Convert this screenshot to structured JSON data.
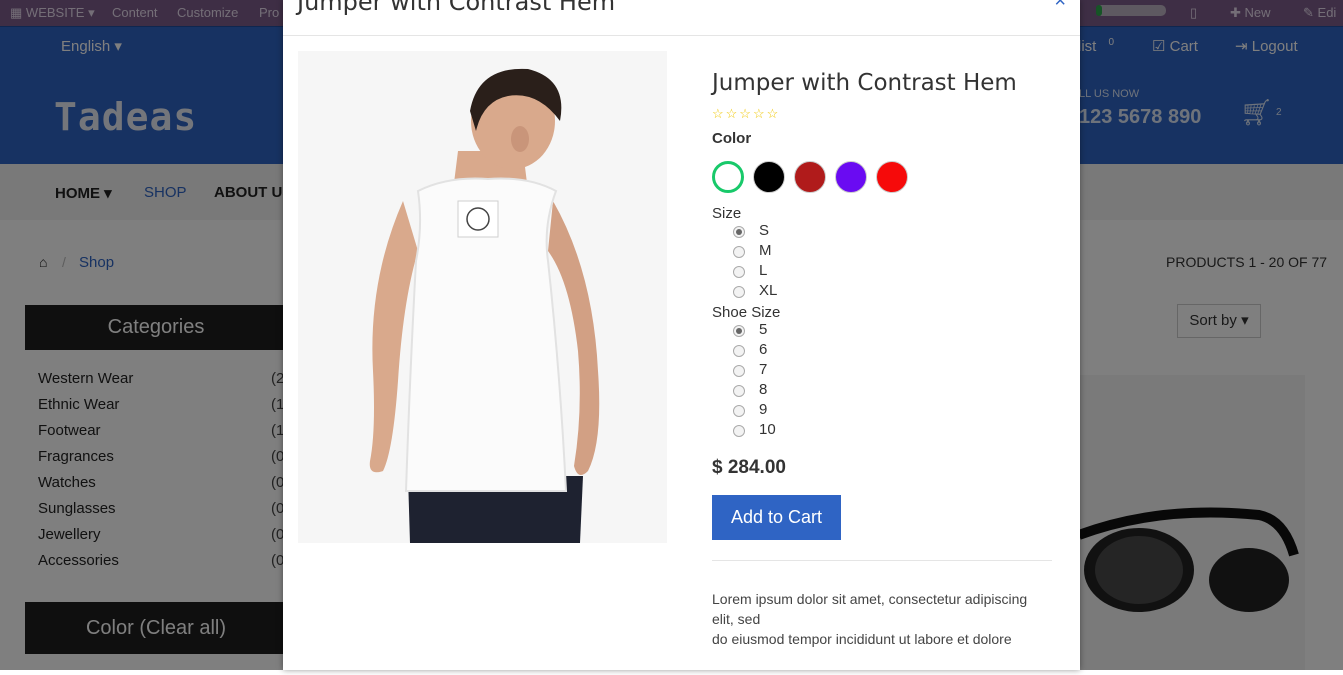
{
  "admin_bar": {
    "website_label": "WEBSITE",
    "content_label": "Content",
    "customize_label": "Customize",
    "promote_label": "Pro",
    "new_label": "New",
    "edit_label": "Edi"
  },
  "top_nav": {
    "language": "English",
    "wishlist_label": "list",
    "wishlist_count": "0",
    "cart_label": "Cart",
    "logout_label": "Logout"
  },
  "header": {
    "logo": "Tadeas",
    "call_label": "LL US NOW",
    "phone": "123 5678 890",
    "cart_count": "2"
  },
  "menu": {
    "home": "HOME",
    "shop": "SHOP",
    "about": "ABOUT US"
  },
  "breadcrumb": {
    "shop": "Shop"
  },
  "products_count": "PRODUCTS 1 - 20 OF 77",
  "sort_label": "Sort by",
  "sidebar": {
    "categories_title": "Categories",
    "categories": [
      {
        "label": "Western Wear",
        "count": "(2"
      },
      {
        "label": "Ethnic Wear",
        "count": "(1"
      },
      {
        "label": "Footwear",
        "count": "(1"
      },
      {
        "label": "Fragrances",
        "count": "(0"
      },
      {
        "label": "Watches",
        "count": "(0"
      },
      {
        "label": "Sunglasses",
        "count": "(0"
      },
      {
        "label": "Jewellery",
        "count": "(0"
      },
      {
        "label": "Accessories",
        "count": "(0"
      }
    ],
    "color_title": "Color (Clear all)"
  },
  "modal": {
    "title": "Jumper with Contrast Hem",
    "close": "×",
    "product_name": "Jumper with Contrast Hem",
    "rating_stars": "☆☆☆☆☆",
    "color_label": "Color",
    "colors": [
      "#ffffff",
      "#000000",
      "#b01b1b",
      "#6a0bf2",
      "#f60a0a"
    ],
    "selected_color_ring": "#18c96a",
    "size_label": "Size",
    "sizes": [
      "S",
      "M",
      "L",
      "XL"
    ],
    "selected_size": "S",
    "shoe_size_label": "Shoe Size",
    "shoe_sizes": [
      "5",
      "6",
      "7",
      "8",
      "9",
      "10"
    ],
    "selected_shoe_size": "5",
    "price": "$ 284.00",
    "add_to_cart": "Add to Cart",
    "description_line1": "Lorem ipsum dolor sit amet, consectetur adipiscing elit, sed",
    "description_line2": "do eiusmod tempor incididunt ut labore et dolore"
  }
}
